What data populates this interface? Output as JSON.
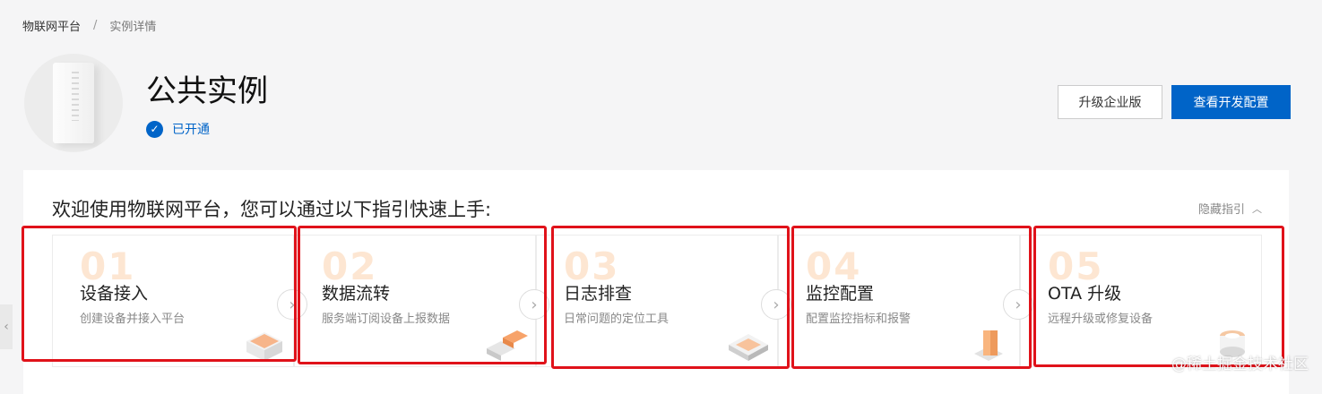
{
  "breadcrumb": {
    "root": "物联网平台",
    "separator": "/",
    "current": "实例详情"
  },
  "instance": {
    "title": "公共实例",
    "status": "已开通",
    "status_icon": "check-circle-icon"
  },
  "actions": {
    "upgrade_label": "升级企业版",
    "config_label": "查看开发配置"
  },
  "guide": {
    "welcome": "欢迎使用物联网平台，您可以通过以下指引快速上手:",
    "hide_label": "隐藏指引",
    "cards": [
      {
        "num": "01",
        "title": "设备接入",
        "subtitle": "创建设备并接入平台"
      },
      {
        "num": "02",
        "title": "数据流转",
        "subtitle": "服务端订阅设备上报数据"
      },
      {
        "num": "03",
        "title": "日志排查",
        "subtitle": "日常问题的定位工具"
      },
      {
        "num": "04",
        "title": "监控配置",
        "subtitle": "配置监控指标和报警"
      },
      {
        "num": "05",
        "title": "OTA 升级",
        "subtitle": "远程升级或修复设备"
      }
    ]
  },
  "watermark": "@稀土掘金技术社区",
  "colors": {
    "accent": "#0064c8",
    "highlight": "#e0121a",
    "number": "#fde6d2"
  }
}
